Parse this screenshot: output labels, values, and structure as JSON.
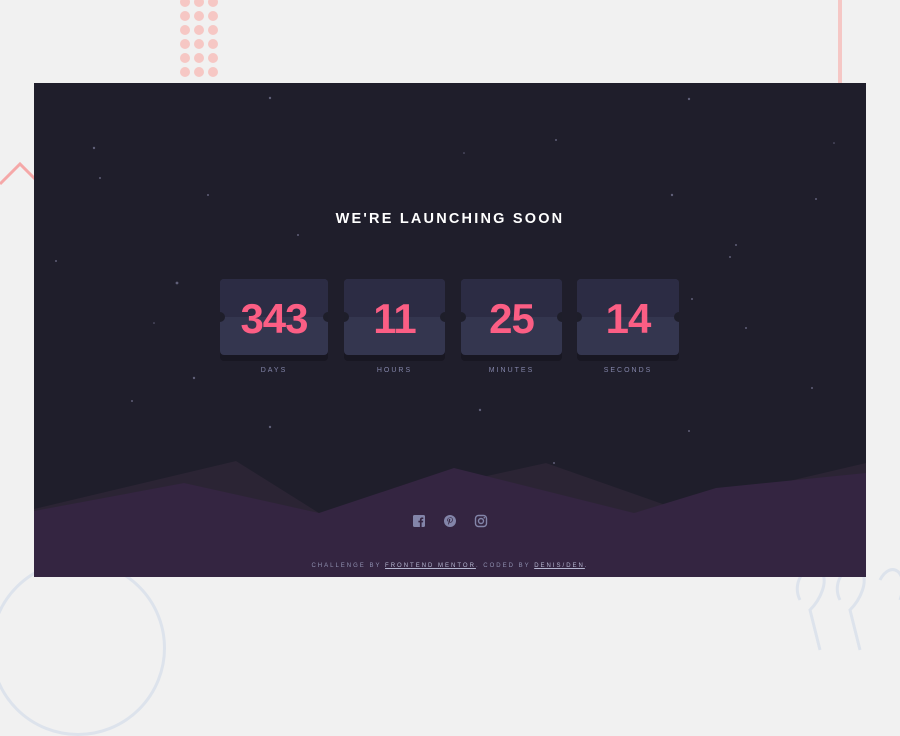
{
  "page": {
    "title": "WE'RE LAUNCHING SOON"
  },
  "countdown": [
    {
      "value": "343",
      "label": "DAYS"
    },
    {
      "value": "11",
      "label": "HOURS"
    },
    {
      "value": "25",
      "label": "MINUTES"
    },
    {
      "value": "14",
      "label": "SECONDS"
    }
  ],
  "social": [
    {
      "icon": "facebook-icon"
    },
    {
      "icon": "pinterest-icon"
    },
    {
      "icon": "instagram-icon"
    }
  ],
  "footer": {
    "prefix": "CHALLENGE BY",
    "link1": "FRONTEND MENTOR",
    "middle": ". CODED BY",
    "link2": "DENIS/DEN",
    "suffix": "."
  },
  "colors": {
    "background": "#1f1e2b",
    "card": "#34364f",
    "accent": "#fb5e84",
    "hills": "#342541",
    "muted_text": "#8385a9"
  }
}
